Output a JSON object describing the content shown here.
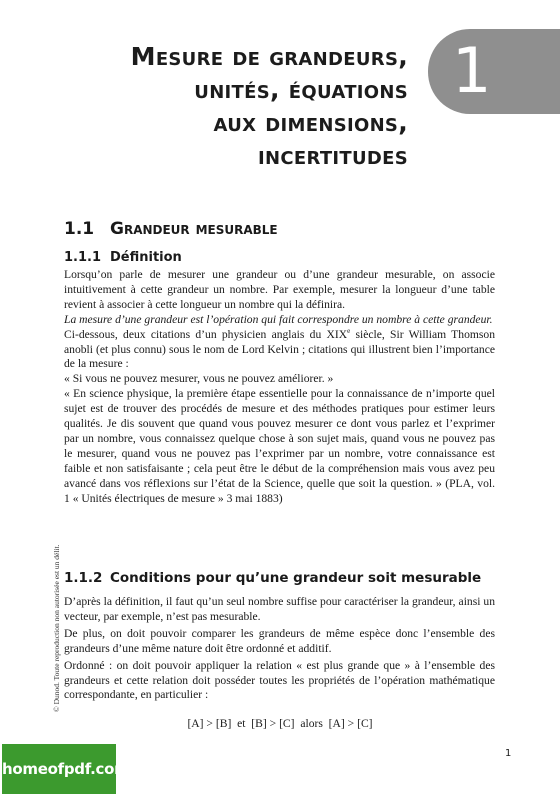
{
  "chapter": {
    "number": "1",
    "title_lines": [
      "Mesure de grandeurs,",
      "unités, équations",
      "aux dimensions,",
      "incertitudes"
    ]
  },
  "section": {
    "number": "1.1",
    "title": "Grandeur mesurable"
  },
  "subsection1": {
    "number": "1.1.1",
    "title": "Définition"
  },
  "paragraphs1": {
    "p1": "Lorsqu’on parle de mesurer une grandeur ou d’une grandeur mesurable, on associe intuitivement à cette grandeur un nombre. Par exemple, mesurer la longueur d’une table revient à associer à cette longueur un nombre qui la définira.",
    "p2": "La mesure d’une grandeur est l’opération qui fait correspondre un nombre à cette grandeur.",
    "p3a": "Ci-dessous, deux citations d’un physicien anglais du XIX",
    "p3sup": "e",
    "p3b": " siècle, Sir William Thomson anobli (et plus connu) sous le nom de Lord Kelvin ; citations qui illustrent bien l’importance de la mesure :",
    "p4": "« Si vous ne pouvez mesurer, vous ne pouvez améliorer. »",
    "p5": "« En science physique, la première étape essentielle pour la connaissance de n’importe quel sujet est de trouver des procédés de mesure et des méthodes pratiques pour estimer leurs qualités. Je dis souvent que quand vous pouvez mesurer ce dont vous parlez et l’exprimer par un nombre, vous connaissez quelque chose à son sujet mais, quand vous ne pouvez pas le mesurer, quand vous ne pouvez pas l’exprimer par un nombre, votre connaissance est faible et non satisfaisante ; cela peut être le début de la compréhension mais vous avez peu avancé dans vos réflexions sur l’état de la Science, quelle que soit la question. » (PLA, vol. 1 « Unités électriques de mesure » 3 mai 1883)"
  },
  "subsection2": {
    "number": "1.1.2",
    "title": "Conditions pour qu’une grandeur soit mesurable"
  },
  "paragraphs2": {
    "p1": "D’après la définition, il faut qu’un seul nombre suffise pour caractériser la grandeur, ainsi un vecteur, par exemple, n’est pas mesurable.",
    "p2": "De plus, on doit pouvoir comparer les grandeurs de même espèce donc l’ensemble des grandeurs d’une même nature doit être ordonné et additif.",
    "p3": "Ordonné : on doit pouvoir appliquer la relation « est plus grande que » à l’ensemble des grandeurs et cette relation doit posséder toutes les propriétés de l’opération mathématique correspondante, en particulier :"
  },
  "formula": "[A] > [B]  et  [B] > [C]  alors  [A] > [C]",
  "side_note": "© Dunod. Toute reproduction non autorisée est un délit.",
  "watermark": "homeofpdf.com",
  "page_number": "1"
}
